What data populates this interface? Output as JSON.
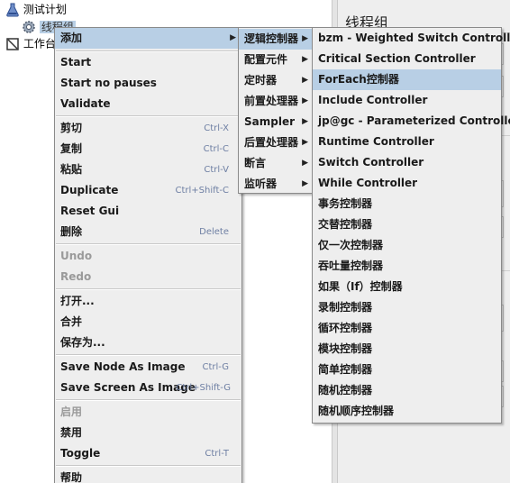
{
  "tree": {
    "test_plan": "测试计划",
    "thread_group": "线程组",
    "workbench": "工作台"
  },
  "right_panel": {
    "title": "线程组"
  },
  "context_menu": {
    "add": "添加",
    "start": "Start",
    "start_no_pauses": "Start no pauses",
    "validate": "Validate",
    "cut": "剪切",
    "cut_sc": "Ctrl-X",
    "copy": "复制",
    "copy_sc": "Ctrl-C",
    "paste": "粘贴",
    "paste_sc": "Ctrl-V",
    "duplicate": "Duplicate",
    "duplicate_sc": "Ctrl+Shift-C",
    "reset_gui": "Reset Gui",
    "delete": "删除",
    "delete_sc": "Delete",
    "undo": "Undo",
    "redo": "Redo",
    "open": "打开...",
    "merge": "合并",
    "save_as": "保存为...",
    "save_node_image": "Save Node As Image",
    "save_node_image_sc": "Ctrl-G",
    "save_screen_image": "Save Screen As Image",
    "save_screen_image_sc": "Ctrl+Shift-G",
    "enable": "启用",
    "disable": "禁用",
    "toggle": "Toggle",
    "toggle_sc": "Ctrl-T",
    "help": "帮助"
  },
  "add_submenu": {
    "logic": "逻辑控制器",
    "config": "配置元件",
    "timer": "定时器",
    "preprocessor": "前置处理器",
    "sampler": "Sampler",
    "postprocessor": "后置处理器",
    "assertion": "断言",
    "listener": "监听器"
  },
  "logic_submenu": [
    "bzm - Weighted Switch Controller",
    "Critical Section Controller",
    "ForEach控制器",
    "Include Controller",
    "jp@gc - Parameterized Controller",
    "Runtime Controller",
    "Switch Controller",
    "While Controller",
    "事务控制器",
    "交替控制器",
    "仅一次控制器",
    "吞吐量控制器",
    "如果（If）控制器",
    "录制控制器",
    "循环控制器",
    "模块控制器",
    "简单控制器",
    "随机控制器",
    "随机顺序控制器"
  ],
  "colors": {
    "highlight": "#b8cfe5",
    "menu_bg": "#eeeeee",
    "shortcut": "#6e7fa3"
  }
}
